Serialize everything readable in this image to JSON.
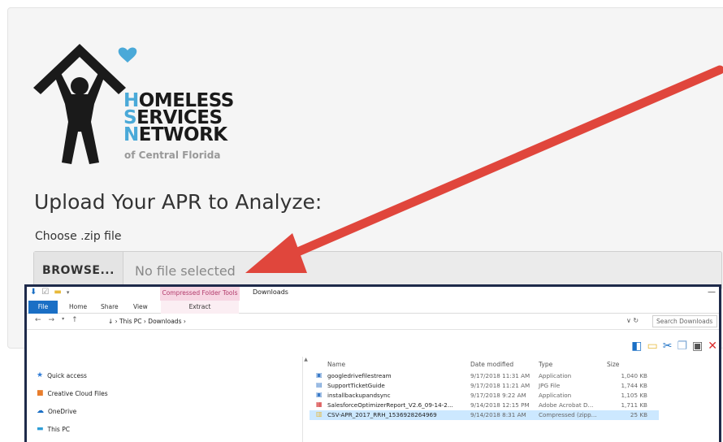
{
  "org": {
    "line1_cap": "H",
    "line1_rest": "OMELESS",
    "line2_cap": "S",
    "line2_rest": "ERVICES",
    "line3_cap": "N",
    "line3_rest": "ETWORK",
    "subtitle": "of Central Florida",
    "colors": {
      "accent": "#4aa9d8",
      "logo_dark": "#1a1a1a",
      "heart": "#4aa9d8"
    }
  },
  "upload": {
    "title": "Upload Your APR to Analyze:",
    "choose_label": "Choose .zip file",
    "browse_label": "BROWSE...",
    "file_placeholder": "No file selected"
  },
  "annotation": {
    "arrow_color": "#e0463c"
  },
  "explorer": {
    "context_tab": "Compressed Folder Tools",
    "window_title": "Downloads",
    "ribbon_tabs": {
      "file": "File",
      "home": "Home",
      "share": "Share",
      "view": "View",
      "extract": "Extract"
    },
    "breadcrumb": "↓ › This PC › Downloads ›",
    "search_placeholder": "Search Downloads",
    "nav_items": [
      {
        "icon": "star-icon",
        "label": "Quick access"
      },
      {
        "icon": "cloud-folder-icon",
        "label": "Creative Cloud Files"
      },
      {
        "icon": "onedrive-icon",
        "label": "OneDrive"
      },
      {
        "icon": "pc-icon",
        "label": "This PC"
      }
    ],
    "columns": {
      "name": "Name",
      "date": "Date modified",
      "type": "Type",
      "size": "Size"
    },
    "files": [
      {
        "icon": "app-icon",
        "name": "googledrivefilestream",
        "date": "9/17/2018 11:31 AM",
        "type": "Application",
        "size": "1,040 KB"
      },
      {
        "icon": "image-icon",
        "name": "SupportTicketGuide",
        "date": "9/17/2018 11:21 AM",
        "type": "JPG File",
        "size": "1,744 KB"
      },
      {
        "icon": "app-icon",
        "name": "installbackupandsync",
        "date": "9/17/2018 9:22 AM",
        "type": "Application",
        "size": "1,105 KB"
      },
      {
        "icon": "pdf-icon",
        "name": "SalesforceOptimizerReport_V2.6_09-14-2...",
        "date": "9/14/2018 12:15 PM",
        "type": "Adobe Acrobat D...",
        "size": "1,711 KB"
      },
      {
        "icon": "zip-icon",
        "name": "CSV-APR_2017_RRH_1536928264969",
        "date": "9/14/2018 8:31 AM",
        "type": "Compressed (zipp...",
        "size": "25 KB"
      }
    ]
  }
}
